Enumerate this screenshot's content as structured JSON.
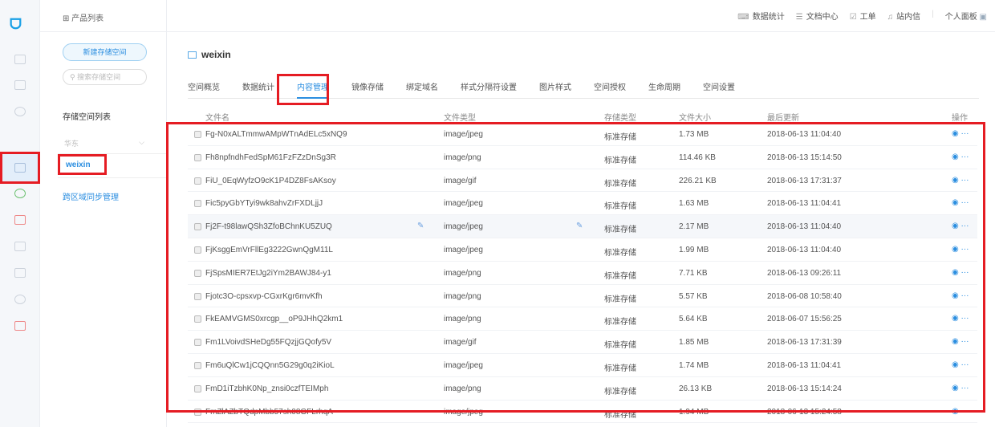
{
  "header": {
    "product_list": "产品列表",
    "nav": [
      {
        "icon": "chart-icon",
        "label": "数据统计"
      },
      {
        "icon": "doc-icon",
        "label": "文档中心"
      },
      {
        "icon": "ticket-icon",
        "label": "工单"
      },
      {
        "icon": "bell-icon",
        "label": "站内信"
      }
    ],
    "profile": "个人面板"
  },
  "sidebar": {
    "new_bucket": "新建存储空间",
    "search_placeholder": "搜索存储空间",
    "list_title": "存储空间列表",
    "region": "华东",
    "bucket": "weixin",
    "sync": "跨区域同步管理"
  },
  "main": {
    "title": "weixin",
    "tabs": [
      "空间概览",
      "数据统计",
      "内容管理",
      "镜像存储",
      "绑定域名",
      "样式分隔符设置",
      "图片样式",
      "空间授权",
      "生命周期",
      "空间设置"
    ],
    "active_tab": "内容管理",
    "columns": [
      "文件名",
      "文件类型",
      "存储类型",
      "文件大小",
      "最后更新",
      "操作"
    ],
    "rows": [
      [
        "Fg-N0xALTmmwAMpWTnAdELc5xNQ9",
        "image/jpeg",
        "标准存储",
        "1.73 MB",
        "2018-06-13 11:04:40"
      ],
      [
        "Fh8npfndhFedSpM61FzFZzDnSg3R",
        "image/png",
        "标准存储",
        "114.46 KB",
        "2018-06-13 15:14:50"
      ],
      [
        "FiU_0EqWyfzO9cK1P4DZ8FsAKsoy",
        "image/gif",
        "标准存储",
        "226.21 KB",
        "2018-06-13 17:31:37"
      ],
      [
        "Fic5pyGbYTyi9wk8ahvZrFXDLjjJ",
        "image/jpeg",
        "标准存储",
        "1.63 MB",
        "2018-06-13 11:04:41"
      ],
      [
        "Fj2F-t98lawQSh3ZfoBChnKU5ZUQ",
        "image/jpeg",
        "标准存储",
        "2.17 MB",
        "2018-06-13 11:04:40"
      ],
      [
        "FjKsggEmVrFllEg3222GwnQgM11L",
        "image/jpeg",
        "标准存储",
        "1.99 MB",
        "2018-06-13 11:04:40"
      ],
      [
        "FjSpsMIER7EtJg2iYm2BAWJ84-y1",
        "image/png",
        "标准存储",
        "7.71 KB",
        "2018-06-13 09:26:11"
      ],
      [
        "Fjotc3O-cpsxvp-CGxrKgr6mvKfh",
        "image/png",
        "标准存储",
        "5.57 KB",
        "2018-06-08 10:58:40"
      ],
      [
        "FkEAMVGMS0xrcgp__oP9JHhQ2km1",
        "image/png",
        "标准存储",
        "5.64 KB",
        "2018-06-07 15:56:25"
      ],
      [
        "Fm1LVoivdSHeDg55FQzjjGQofy5V",
        "image/gif",
        "标准存储",
        "1.85 MB",
        "2018-06-13 17:31:39"
      ],
      [
        "Fm6uQlCw1jCQQnn5G29g0q2iKioL",
        "image/jpeg",
        "标准存储",
        "1.74 MB",
        "2018-06-13 11:04:41"
      ],
      [
        "FmD1iTzbhK0Np_znsi0czfTEIMph",
        "image/png",
        "标准存储",
        "26.13 KB",
        "2018-06-13 15:14:24"
      ],
      [
        "FmZlAZbTQdpMbb57sh08GFLrhqA",
        "image/jpeg",
        "标准存储",
        "1.94 MB",
        "2018-06-13 15:24:58"
      ]
    ],
    "highlight_row": 4
  },
  "colors": {
    "accent": "#2b8ee0",
    "annotation": "#e51c23"
  }
}
